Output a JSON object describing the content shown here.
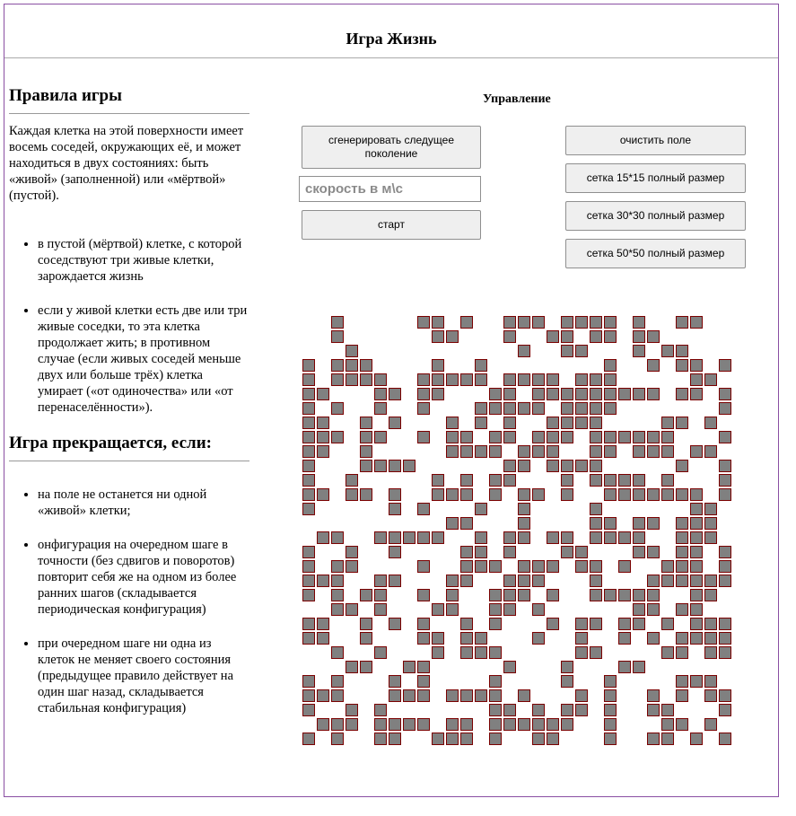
{
  "header": {
    "title": "Игра Жизнь"
  },
  "rules": {
    "title": "Правила игры",
    "intro": "Каждая клетка на этой поверхности имеет восемь соседей, окружающих её, и может находиться в двух состояниях: быть «живой» (заполненной) или «мёртвой» (пустой).",
    "items": [
      "в пустой (мёртвой) клетке, с которой соседствуют три живые клетки, зарождается жизнь",
      "если у живой клетки есть две или три живые соседки, то эта клетка продолжает жить; в противном случае (если живых соседей меньше двух или больше трёх) клетка умирает («от одиночества» или «от перенаселённости»)."
    ]
  },
  "end": {
    "title": "Игра прекращается, если:",
    "items": [
      "на поле не останется ни одной «живой» клетки;",
      "онфигурация на очередном шаге в точности (без сдвигов и поворотов) повторит себя же на одном из более ранних шагов (складывается периодическая конфигурация)",
      "при очередном шаге ни одна из клеток не меняет своего состояния (предыдущее правило действует на один шаг назад, складывается стабильная конфигурация)"
    ]
  },
  "controls": {
    "title": "Управление",
    "generate_label": "сгенерировать следущее поколение",
    "speed_placeholder": "скорость в м\\с",
    "start_label": "старт",
    "clear_label": "очистить поле",
    "grid15_label": "сетка 15*15 полный размер",
    "grid30_label": "сетка 30*30 полный размер",
    "grid50_label": "сетка 50*50 полный размер"
  },
  "colors": {
    "cell_fill": "#808080",
    "cell_border": "#7a0000",
    "frame": "#8a4fa3"
  },
  "board": {
    "rows": 30,
    "cols": 30,
    "cells": [
      "..#.....##.#..###.####.#..##..",
      "..#......##...#..##.##.##.....",
      "...#...........#..##...#.##...",
      "#.###....#..#........#..#.##.#",
      "#.####..#####.####.###.....##",
      "##...##.##...##.#########.##.#",
      "#.#..#..#...#####.####.......#",
      "##..#.#...#.#.#..####....##.#.",
      "###.##..#.##.##.###.######...#",
      "##..#.....####.###..##.###.##.",
      "#...####......##.####.....#..#",
      "#..#.....#.#.##...#.####.#...#",
      "##.##.#..###.#.##.#..#######.#",
      "#.....#.#...#..#....#......##.",
      "..........##...#....##.##.###.",
      ".##..#####..#.##.##.####..###.",
      "#..#..#....##.#...##...##.##.#",
      "#.##....#..###.###.##.#..###.#",
      "###..##...##..###...#...######",
      "#.#.##..#.#..###.#..#####..##.",
      "..##.#...##..##.#......##.##.",
      "##..#.#.#..#.#...#.##.##.#.###",
      "##..#...##.##...#..#..#.#.####",
      "..#..#...#.###.....##....##.##",
      "...##..##.....#...#...##......",
      "#.#...#.#....#....#..#....###.",
      "###...###.####.#...#.#..#.#.##",
      "#..#.#.......##.#.##.#..##...#",
      ".###.####.##.######..#...##.#.",
      "#.#..##..###.#..##...#..##.#.#"
    ]
  }
}
